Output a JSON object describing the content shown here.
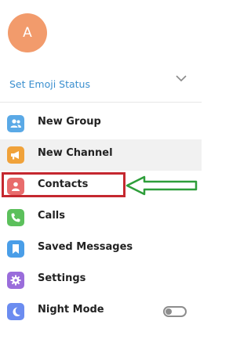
{
  "profile": {
    "avatar_initial": "A",
    "avatar_color": "#f29b6c",
    "emoji_status_label": "Set Emoji Status"
  },
  "menu": {
    "items": [
      {
        "label": "New Group",
        "icon": "group-icon",
        "color": "#5aa9e6"
      },
      {
        "label": "New Channel",
        "icon": "megaphone-icon",
        "color": "#f0a23a"
      },
      {
        "label": "Contacts",
        "icon": "contact-icon",
        "color": "#e86c6c"
      },
      {
        "label": "Calls",
        "icon": "phone-icon",
        "color": "#5cc05c"
      },
      {
        "label": "Saved Messages",
        "icon": "bookmark-icon",
        "color": "#4a9ee8"
      },
      {
        "label": "Settings",
        "icon": "gear-icon",
        "color": "#9a6ddb"
      },
      {
        "label": "Night Mode",
        "icon": "moon-icon",
        "color": "#6b8cf0"
      }
    ]
  },
  "annotation": {
    "highlight_color": "#c5282f",
    "arrow_color": "#2e9e3a"
  }
}
